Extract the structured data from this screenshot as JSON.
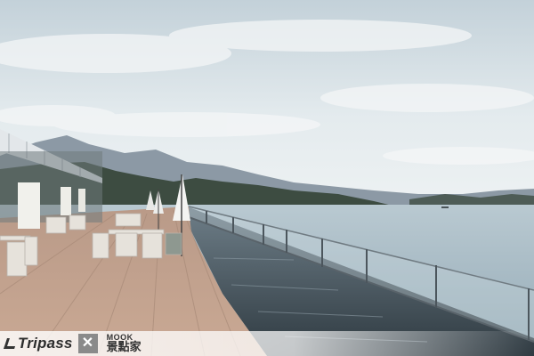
{
  "watermark": {
    "brand_left": "Tripass",
    "brand_mid_top": "MOOK",
    "brand_mid_bottom": "景點家"
  },
  "colors": {
    "sky_top": "#c9d6dd",
    "sky_bottom": "#e9eef0",
    "mountains_far": "#8e9aa6",
    "hills_near": "#3b4a3e",
    "lake": "#a9bcc6",
    "pool": "#46545d",
    "deck": "#c7a896"
  }
}
